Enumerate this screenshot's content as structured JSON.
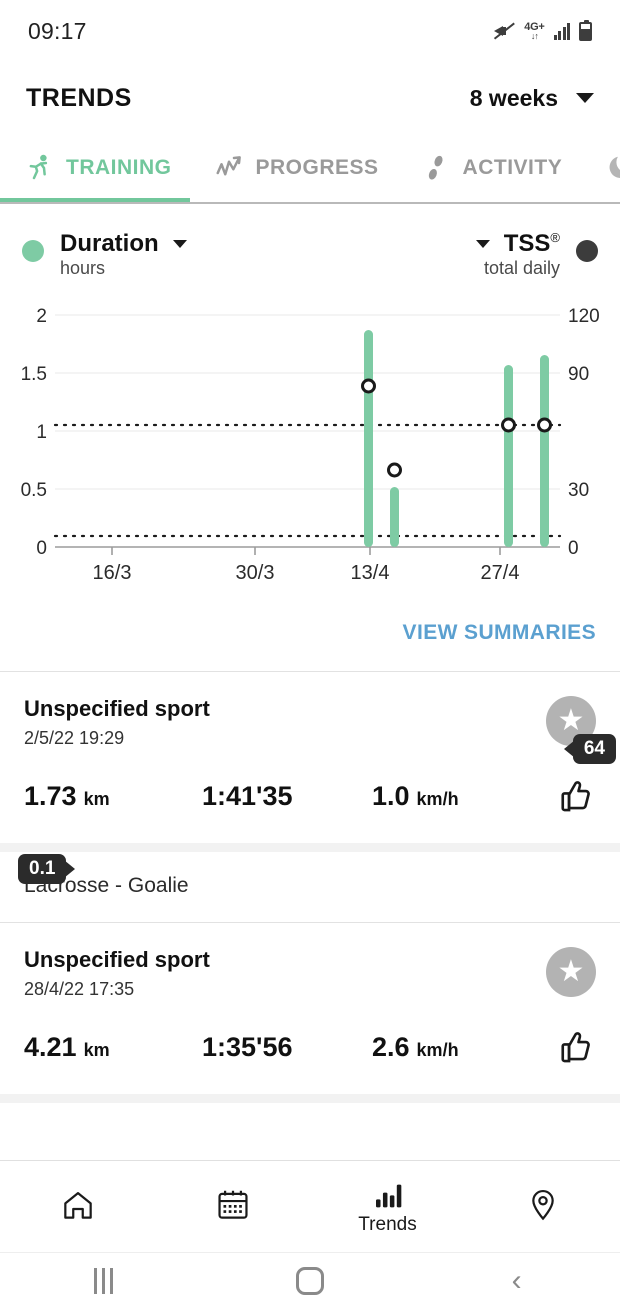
{
  "status_bar": {
    "time": "09:17",
    "icons": [
      "mute-icon",
      "network-4g-plus-icon",
      "signal-icon",
      "battery-icon"
    ],
    "network_label": "4G+",
    "network_arrows": "↓↑"
  },
  "header": {
    "title": "TRENDS",
    "period_label": "8 weeks"
  },
  "tabs": [
    {
      "label": "TRAINING",
      "icon": "running-icon",
      "active": true
    },
    {
      "label": "PROGRESS",
      "icon": "trend-up-icon",
      "active": false
    },
    {
      "label": "ACTIVITY",
      "icon": "footsteps-icon",
      "active": false
    },
    {
      "label": "",
      "icon": "moon-icon",
      "active": false
    }
  ],
  "metrics": {
    "left": {
      "name": "Duration",
      "unit": "hours",
      "color": "#7ecba4"
    },
    "right": {
      "name": "TSS",
      "trademark": "®",
      "unit": "total daily",
      "color": "#3c3c3c"
    }
  },
  "chart_data": {
    "type": "bar",
    "title": "",
    "xlabel": "",
    "ylabel": "hours",
    "y2label": "TSS total daily",
    "ylim": [
      0,
      2
    ],
    "y2lim": [
      0,
      120
    ],
    "yticks": [
      "0",
      "0.5",
      "1",
      "1.5",
      "2"
    ],
    "y2ticks": [
      "0",
      "30",
      "60",
      "90",
      "120"
    ],
    "y2ticks_shown": [
      "0",
      "30",
      "90",
      "120"
    ],
    "xticks": [
      "16/3",
      "30/3",
      "13/4",
      "27/4"
    ],
    "grid": true,
    "legend_position": "top",
    "threshold_lines": [
      {
        "label": "0.1",
        "axis": "left",
        "value": 0.1
      },
      {
        "label": "64",
        "axis": "right",
        "value": 64
      }
    ],
    "series": [
      {
        "name": "Duration",
        "type": "bar",
        "axis": "left",
        "color": "#7ecba4",
        "x": [
          "13/4",
          "16/4",
          "27/4",
          "30/4"
        ],
        "values": [
          1.85,
          0.52,
          1.57,
          1.66
        ]
      },
      {
        "name": "TSS",
        "type": "scatter",
        "axis": "right",
        "color": "#2b2b2b",
        "x": [
          "13/4",
          "16/4",
          "27/4",
          "30/4"
        ],
        "values": [
          82,
          40,
          66,
          66
        ]
      }
    ]
  },
  "summaries": {
    "link_label": "VIEW SUMMARIES"
  },
  "activities": [
    {
      "name": "Unspecified sport",
      "date": "2/5/22 19:29",
      "distance_value": "1.73",
      "distance_unit": "km",
      "duration": "1:41'35",
      "speed_value": "1.0",
      "speed_unit": "km/h",
      "badge": "star-icon",
      "action": "thumbs-up-icon"
    },
    {
      "name": "Lacrosse - Goalie",
      "is_subtitle_only": true
    },
    {
      "name": "Unspecified sport",
      "date": "28/4/22 17:35",
      "distance_value": "4.21",
      "distance_unit": "km",
      "duration": "1:35'56",
      "speed_value": "2.6",
      "speed_unit": "km/h",
      "badge": "star-icon",
      "action": "thumbs-up-icon"
    }
  ],
  "bottom_nav": [
    {
      "label": "",
      "icon": "home-icon",
      "active": false
    },
    {
      "label": "",
      "icon": "calendar-icon",
      "active": false
    },
    {
      "label": "Trends",
      "icon": "bar-chart-icon",
      "active": true
    },
    {
      "label": "",
      "icon": "location-pin-icon",
      "active": false
    }
  ],
  "android_nav": [
    "recents-icon",
    "home-icon",
    "back-icon"
  ],
  "colors": {
    "accent_green": "#72c79c",
    "bar_green": "#7ecba4",
    "link_blue": "#5ba0d0",
    "badge_dark": "#2b2b2b",
    "muted_grey": "#9a9a9a"
  }
}
